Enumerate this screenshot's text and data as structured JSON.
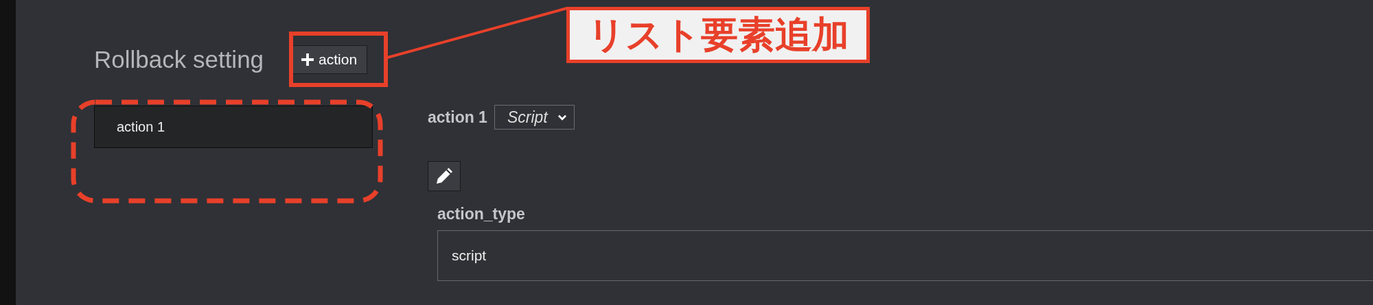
{
  "section": {
    "title": "Rollback setting",
    "add_button": {
      "label": "action"
    }
  },
  "list": [
    {
      "label": "action 1",
      "selected": true
    }
  ],
  "detail": {
    "title": "action 1",
    "type_select": {
      "value": "Script"
    },
    "fields": [
      {
        "label": "action_type",
        "value": "script"
      }
    ]
  },
  "annotation": {
    "callout": "リスト要素追加"
  }
}
